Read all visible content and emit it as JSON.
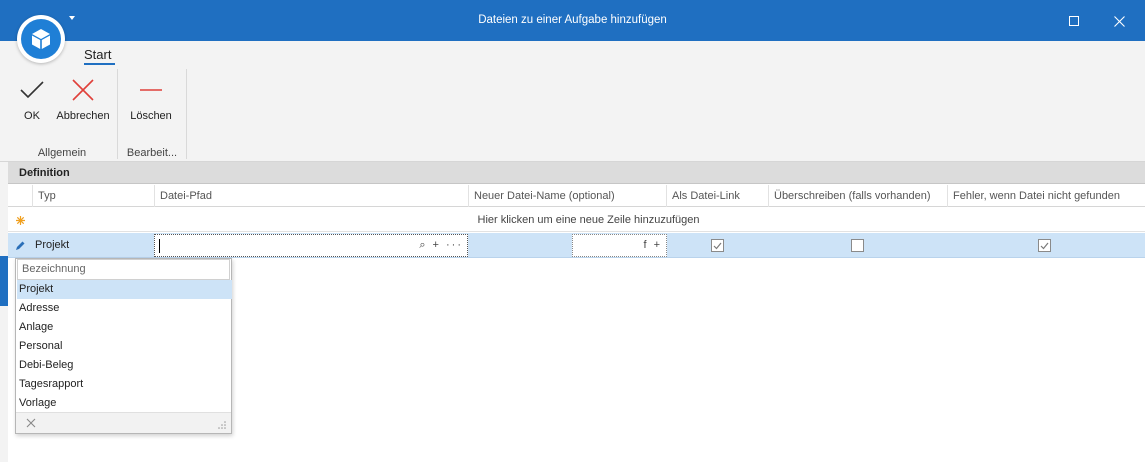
{
  "window": {
    "title": "Dateien zu einer Aufgabe hinzufügen"
  },
  "ribbon": {
    "tab": "Start",
    "buttons": {
      "ok": "OK",
      "cancel": "Abbrechen",
      "delete": "Löschen"
    },
    "groups": {
      "general": "Allgemein",
      "edit": "Bearbeit..."
    }
  },
  "section": {
    "title": "Definition"
  },
  "grid": {
    "columns": {
      "typ": "Typ",
      "path": "Datei-Pfad",
      "newname": "Neuer Datei-Name (optional)",
      "link": "Als Datei-Link",
      "overwrite": "Überschreiben (falls vorhanden)",
      "error": "Fehler, wenn Datei nicht gefunden"
    },
    "new_row_hint": "Hier klicken um eine neue Zeile hinzuzufügen",
    "row": {
      "typ": "Projekt",
      "path": "",
      "path_buttons": "⌕ + ···",
      "name_buttons": "f +",
      "as_link": true,
      "overwrite": false,
      "error_if_missing": true
    }
  },
  "dropdown": {
    "header": "Bezeichnung",
    "items": [
      "Projekt",
      "Adresse",
      "Anlage",
      "Personal",
      "Debi-Beleg",
      "Tagesrapport",
      "Vorlage"
    ],
    "selected": "Projekt"
  },
  "colors": {
    "titlebar": "#1f6fc1",
    "selection": "#cde3f7",
    "cancel_red": "#e0403a"
  }
}
